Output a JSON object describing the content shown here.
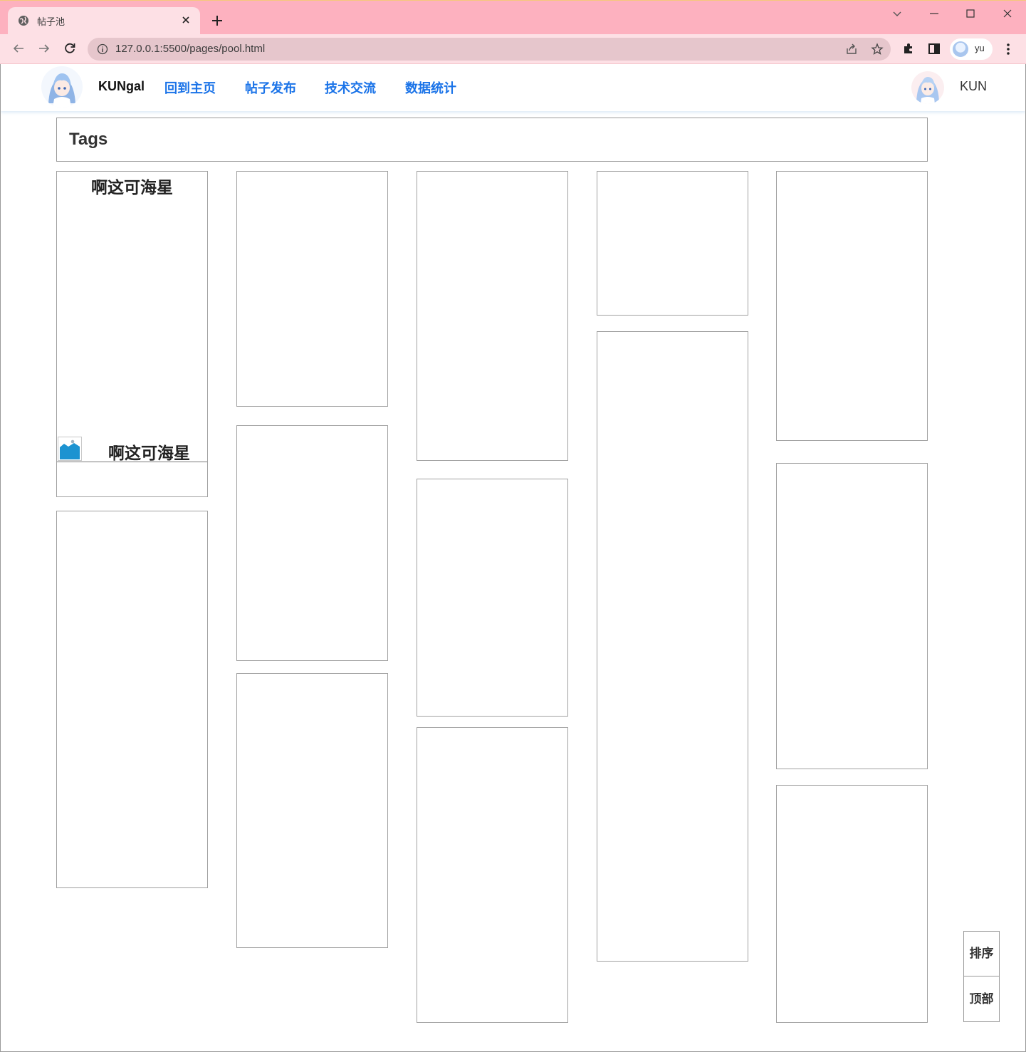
{
  "browser": {
    "tab_title": "帖子池",
    "url": "127.0.0.1:5500/pages/pool.html",
    "profile_name": "yu"
  },
  "header": {
    "brand": "KUNgal",
    "nav": [
      {
        "label": "回到主页"
      },
      {
        "label": "帖子发布"
      },
      {
        "label": "技术交流"
      },
      {
        "label": "数据统计"
      }
    ],
    "user_name": "KUN"
  },
  "tags": {
    "title": "Tags"
  },
  "posts": {
    "featured_title": "啊这可海星",
    "featured_author": "啊这可海星"
  },
  "side_buttons": {
    "sort": "排序",
    "top": "顶部"
  },
  "colors": {
    "titlebar": "#fdb1bf",
    "toolbar": "#fde0e5",
    "nav_link": "#1a73e8"
  }
}
